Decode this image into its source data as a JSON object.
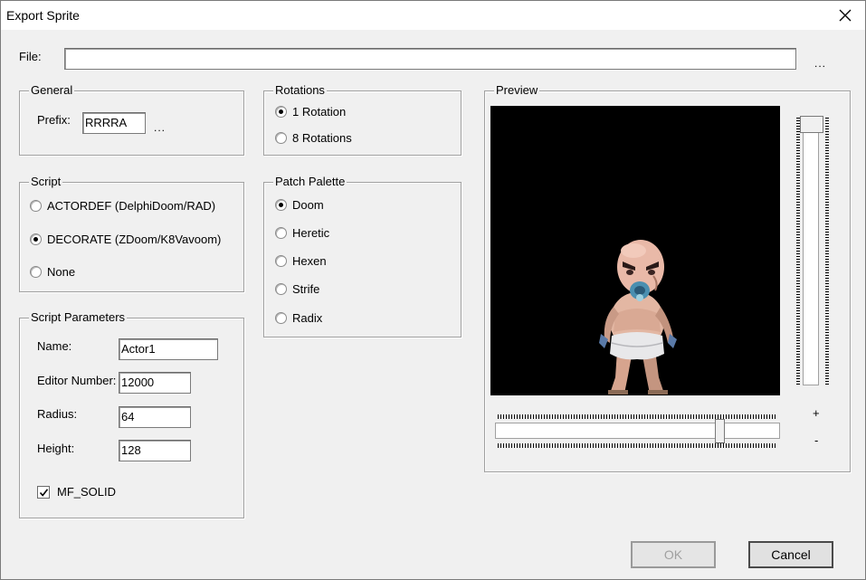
{
  "window": {
    "title": "Export Sprite"
  },
  "file": {
    "label": "File:",
    "value": "",
    "browse": "..."
  },
  "general": {
    "title": "General",
    "prefix_label": "Prefix:",
    "prefix_value": "RRRRA",
    "browse": "..."
  },
  "rotations": {
    "title": "Rotations",
    "options": [
      {
        "label": "1 Rotation",
        "checked": true
      },
      {
        "label": "8 Rotations",
        "checked": false
      }
    ]
  },
  "script": {
    "title": "Script",
    "options": [
      {
        "label": "ACTORDEF (DelphiDoom/RAD)",
        "checked": false
      },
      {
        "label": "DECORATE (ZDoom/K8Vavoom)",
        "checked": true
      },
      {
        "label": "None",
        "checked": false
      }
    ]
  },
  "palette": {
    "title": "Patch Palette",
    "options": [
      {
        "label": "Doom",
        "checked": true
      },
      {
        "label": "Heretic",
        "checked": false
      },
      {
        "label": "Hexen",
        "checked": false
      },
      {
        "label": "Strife",
        "checked": false
      },
      {
        "label": "Radix",
        "checked": false
      }
    ]
  },
  "params": {
    "title": "Script Parameters",
    "name_label": "Name:",
    "name_value": "Actor1",
    "editor_label": "Editor Number:",
    "editor_value": "12000",
    "radius_label": "Radius:",
    "radius_value": "64",
    "height_label": "Height:",
    "height_value": "128",
    "solid_label": "MF_SOLID",
    "solid_checked": true
  },
  "preview": {
    "title": "Preview",
    "zoom_in": "+",
    "zoom_out": "-",
    "horizontal_slider_level": 0.8,
    "vertical_slider_level": 0.0
  },
  "buttons": {
    "ok": "OK",
    "cancel": "Cancel"
  },
  "icons": {
    "close": "close-icon",
    "check": "check-icon",
    "sprite": "sprite-image"
  }
}
